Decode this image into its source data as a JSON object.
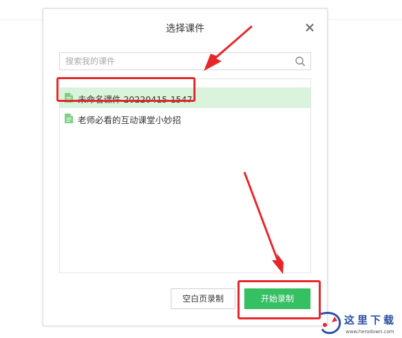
{
  "dialog": {
    "title": "选择课件",
    "close_icon": "close-icon"
  },
  "search": {
    "placeholder": "搜索我的课件",
    "value": "",
    "icon": "search-icon"
  },
  "files": [
    {
      "name": "未命名课件 20220415-1547",
      "selected": true,
      "icon": "document-icon"
    },
    {
      "name": "老师必看的互动课堂小妙招",
      "selected": false,
      "icon": "document-icon"
    }
  ],
  "buttons": {
    "blank_record": "空白页录制",
    "start_record": "开始录制"
  },
  "watermark": {
    "title": "这里下载",
    "url": "www.herodown.com"
  },
  "colors": {
    "accent_green": "#35c063",
    "selected_row": "#daf3dd",
    "file_icon": "#7ecf86",
    "annotation_red": "#e8262a",
    "watermark_blue": "#2b4fa3"
  }
}
